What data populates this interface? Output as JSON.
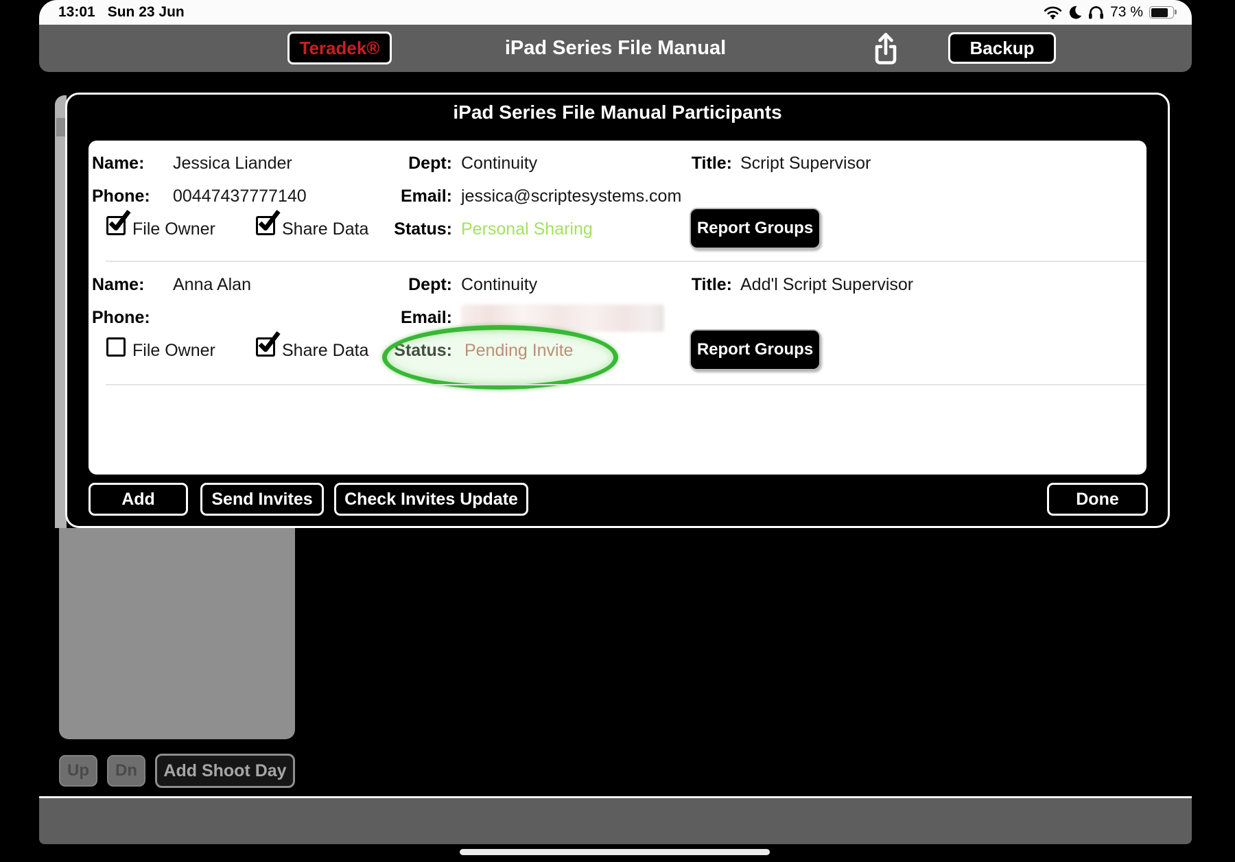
{
  "status_bar": {
    "time": "13:01",
    "date": "Sun 23 Jun",
    "battery_percent": "73 %",
    "icons": [
      "wifi-icon",
      "moon-icon",
      "headphones-icon",
      "battery-icon"
    ]
  },
  "toolbar": {
    "brand_button": "Teradek®",
    "title": "iPad Series File Manual",
    "share_icon": "share-upload-icon",
    "backup_button": "Backup"
  },
  "dialog": {
    "title": "iPad Series File Manual Participants",
    "labels": {
      "name": "Name:",
      "phone": "Phone:",
      "dept": "Dept:",
      "email": "Email:",
      "title": "Title:",
      "status": "Status:",
      "file_owner": "File Owner",
      "share_data": "Share Data",
      "report_groups": "Report Groups"
    },
    "participants": [
      {
        "name": "Jessica Liander",
        "phone": "00447437777140",
        "dept": "Continuity",
        "email": "jessica@scriptesystems.com",
        "email_redacted": false,
        "title": "Script Supervisor",
        "file_owner_checked": true,
        "share_data_checked": true,
        "status": "Personal Sharing",
        "status_color": "#a3e35c",
        "annotated": false
      },
      {
        "name": "Anna Alan",
        "phone": "",
        "dept": "Continuity",
        "email": "",
        "email_redacted": true,
        "title": "Add'l Script Supervisor",
        "file_owner_checked": false,
        "share_data_checked": true,
        "status": "Pending Invite",
        "status_color": "#b4604c",
        "annotated": true
      }
    ],
    "footer_buttons": {
      "add": "Add",
      "send_invites": "Send Invites",
      "check_invites_update": "Check Invites Update",
      "done": "Done"
    }
  },
  "background_ui": {
    "up_button": "Up",
    "dn_button": "Dn",
    "add_shoot_day_button": "Add Shoot Day"
  },
  "colors": {
    "annotation_green": "#38b834",
    "status_personal_sharing": "#a3e35c",
    "status_pending_invite": "#b4604c",
    "teradek_red": "#cc1f1f",
    "toolbar_gray": "#5e5e5e"
  }
}
